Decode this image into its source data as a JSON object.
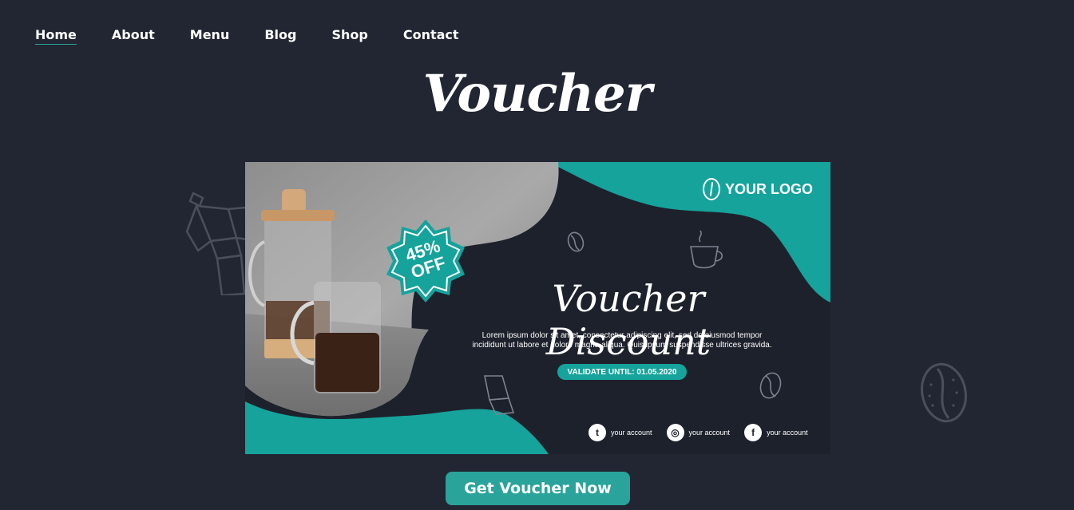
{
  "nav": {
    "items": [
      {
        "label": "Home",
        "active": true
      },
      {
        "label": "About",
        "active": false
      },
      {
        "label": "Menu",
        "active": false
      },
      {
        "label": "Blog",
        "active": false
      },
      {
        "label": "Shop",
        "active": false
      },
      {
        "label": "Contact",
        "active": false
      }
    ]
  },
  "page": {
    "title": "Voucher"
  },
  "voucher": {
    "logo_text": "YOUR LOGO",
    "badge": {
      "percent": "45%",
      "off": "OFF"
    },
    "heading": "Voucher Discount",
    "body_line1": "Lorem ipsum dolor sit amet, consectetur adipiscing elit, sed do eiusmod tempor",
    "body_line2": "incididunt ut labore et dolore magna aliqua. Quis ipsum suspendisse ultrices gravida.",
    "validity": "VALIDATE UNTIL: 01.05.2020",
    "socials": [
      {
        "icon": "twitter-icon",
        "glyph": "t",
        "handle": "your account"
      },
      {
        "icon": "instagram-icon",
        "glyph": "◎",
        "handle": "your account"
      },
      {
        "icon": "facebook-icon",
        "glyph": "f",
        "handle": "your account"
      }
    ]
  },
  "cta": {
    "label": "Get Voucher Now"
  },
  "colors": {
    "background": "#212632",
    "accent": "#2aa39b",
    "banner_dark": "#1d212c"
  }
}
